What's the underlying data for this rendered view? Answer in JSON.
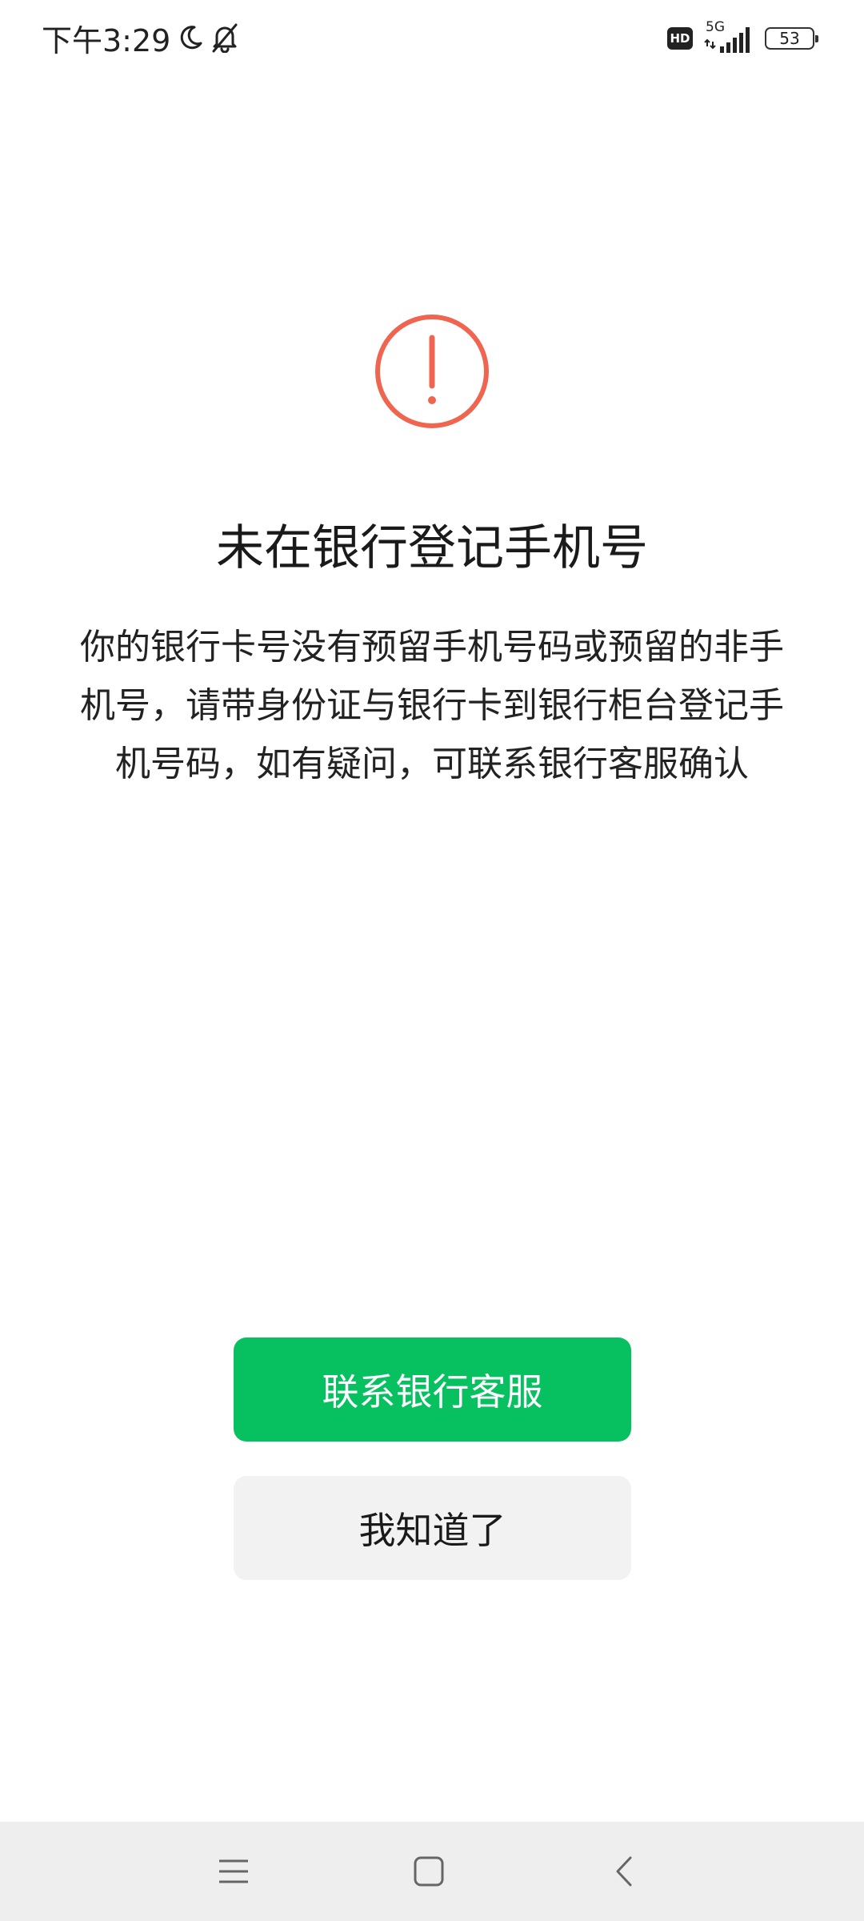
{
  "status_bar": {
    "time": "下午3:29",
    "hd_label": "HD",
    "network_label": "5G",
    "battery_level": "53",
    "icons": [
      "moon-icon",
      "bell-off-icon",
      "hd-icon",
      "signal-icon",
      "battery-icon"
    ]
  },
  "dialog": {
    "icon": "exclamation-circle-icon",
    "icon_color": "#f0654f",
    "title": "未在银行登记手机号",
    "description": "你的银行卡号没有预留手机号码或预留的非手机号，请带身份证与银行卡到银行柜台登记手机号码，如有疑问，可联系银行客服确认"
  },
  "actions": {
    "primary_label": "联系银行客服",
    "primary_color": "#07c160",
    "secondary_label": "我知道了"
  },
  "nav_bar": {
    "icons": [
      "menu-icon",
      "home-icon",
      "back-icon"
    ]
  }
}
